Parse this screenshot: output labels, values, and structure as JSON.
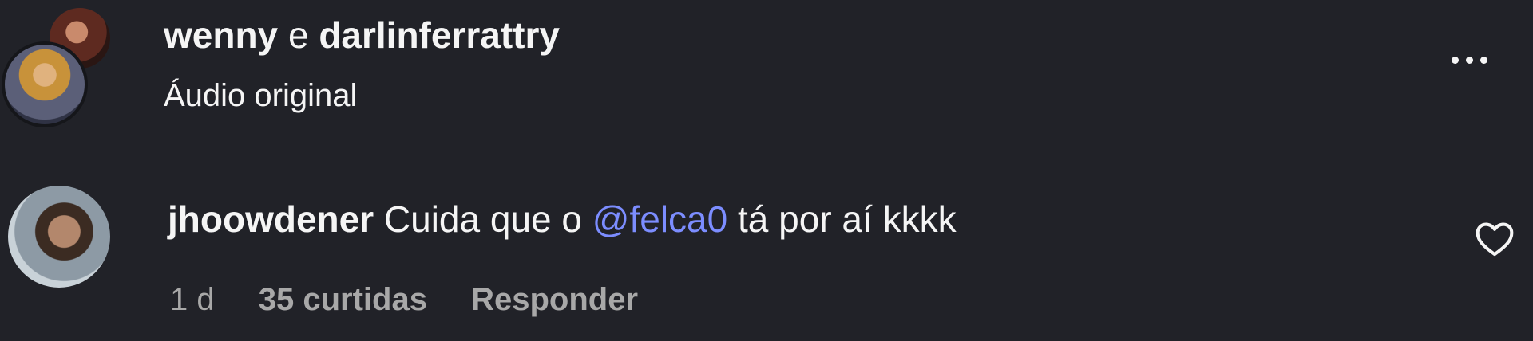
{
  "post": {
    "author_primary": "wenny",
    "author_separator": "e",
    "author_secondary": "darlinferrattry",
    "audio_label": "Áudio original",
    "more_icon": "more-horizontal-icon"
  },
  "comment": {
    "username": "jhoowdener",
    "text_before_mention": "Cuida que o",
    "mention": "@felca0",
    "text_after_mention": "tá por aí kkkk",
    "time": "1 d",
    "likes": "35 curtidas",
    "reply_label": "Responder",
    "like_icon": "heart-outline-icon"
  },
  "colors": {
    "background": "#212228",
    "text": "#f5f5f5",
    "muted": "#a8a8a8",
    "mention": "#7c8dff"
  }
}
